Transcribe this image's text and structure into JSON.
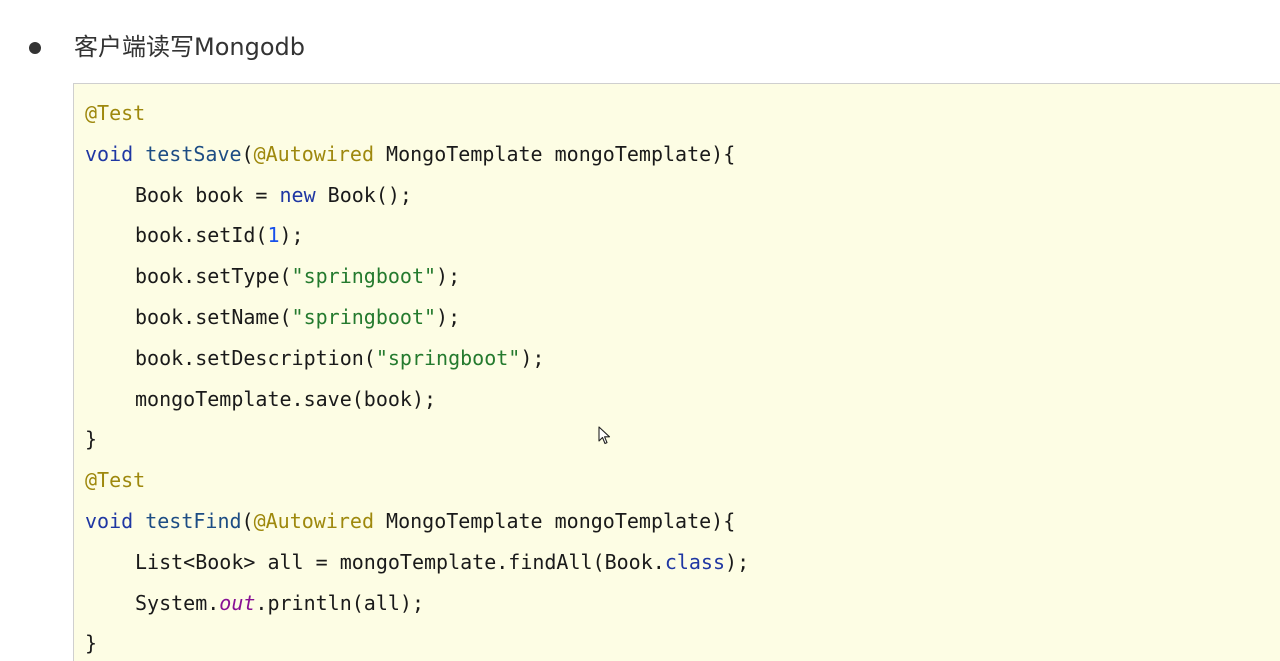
{
  "heading": {
    "bullet_text": "客户端读写Mongodb"
  },
  "code": {
    "l1": {
      "ann": "@Test"
    },
    "l2": {
      "kw": "void",
      "sp": " ",
      "fn": "testSave",
      "p1": "(",
      "ann": "@Autowired",
      "rest": " MongoTemplate mongoTemplate){"
    },
    "l3": {
      "a": "Book book = ",
      "kw": "new",
      "b": " Book();"
    },
    "l4": {
      "a": "book.setId(",
      "num": "1",
      "b": ");"
    },
    "l5": {
      "a": "book.setType(",
      "str": "\"springboot\"",
      "b": ");"
    },
    "l6": {
      "a": "book.setName(",
      "str": "\"springboot\"",
      "b": ");"
    },
    "l7": {
      "a": "book.setDescription(",
      "str": "\"springboot\"",
      "b": ");"
    },
    "l8": {
      "a": "mongoTemplate.save(book);"
    },
    "l9": {
      "a": "}"
    },
    "l10": {
      "ann": "@Test"
    },
    "l11": {
      "kw": "void",
      "sp": " ",
      "fn": "testFind",
      "p1": "(",
      "ann": "@Autowired",
      "rest": " MongoTemplate mongoTemplate){"
    },
    "l12": {
      "a": "List<Book> all = mongoTemplate.findAll(Book.",
      "kw": "class",
      "b": ");"
    },
    "l13": {
      "a": "System.",
      "field": "out",
      "b": ".println(all);"
    },
    "l14": {
      "a": "}"
    }
  },
  "colors": {
    "code_background": "#fdfde4",
    "annotation": "#9e880d",
    "keyword": "#1f37a3",
    "string": "#247a2e",
    "number": "#1750eb",
    "field": "#871094"
  },
  "icons": {
    "cursor": "mouse-pointer-icon"
  }
}
